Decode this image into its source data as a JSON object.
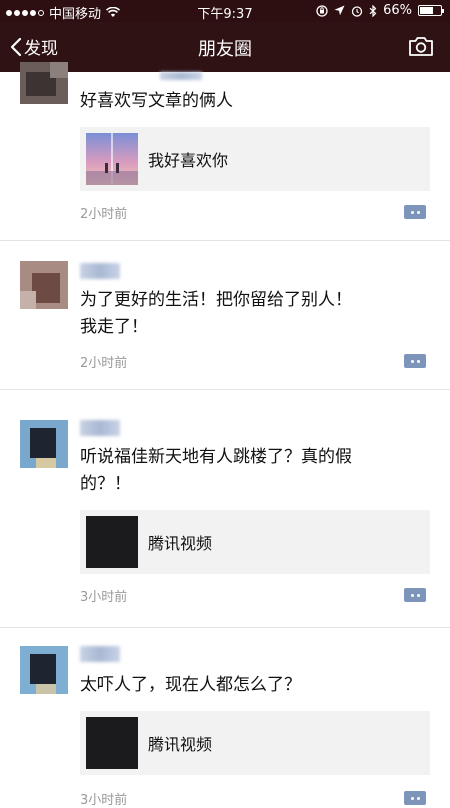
{
  "statusbar": {
    "carrier": "中国移动",
    "time": "下午9:37",
    "battery": "66%",
    "battery_level": 0.66,
    "icons": [
      "signal-dots-icon",
      "wifi-icon",
      "rotation-lock-icon",
      "location-icon",
      "alarm-icon",
      "bluetooth-icon",
      "battery-icon"
    ]
  },
  "navbar": {
    "back_label": "发现",
    "title": "朋友圈",
    "camera_icon": "camera-icon"
  },
  "colors": {
    "nav_bg": "#2f1214",
    "time_text": "#9a9a9a",
    "card_bg": "#f2f2f2",
    "comment_icon": "#7d95bb"
  },
  "posts": [
    {
      "text": "好喜欢写文章的俩人",
      "link_title": "我好喜欢你",
      "time": "2小时前"
    },
    {
      "text_lines": [
        "为了更好的生活！把你留给了别人！",
        "我走了！"
      ],
      "time": "2小时前"
    },
    {
      "text_lines": [
        "听说福佳新天地有人跳楼了？真的假",
        "的？！"
      ],
      "link_title": "腾讯视频",
      "time": "3小时前"
    },
    {
      "text": "太吓人了，现在人都怎么了？",
      "link_title": "腾讯视频",
      "time": "3小时前"
    }
  ]
}
